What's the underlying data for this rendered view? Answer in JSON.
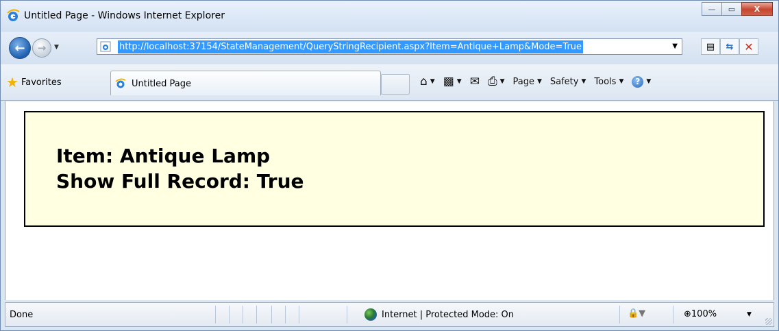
{
  "window": {
    "title": "Untitled Page - Windows Internet Explorer",
    "controls": {
      "minimize": "—",
      "maximize": "▭",
      "close": "X"
    }
  },
  "address_bar": {
    "url": "http://localhost:37154/StateManagement/QueryStringRecipient.aspx?Item=Antique+Lamp&Mode=True",
    "back_icon": "back-arrow-icon",
    "forward_icon": "forward-arrow-icon"
  },
  "favorites": {
    "label": "Favorites"
  },
  "tab": {
    "label": "Untitled Page"
  },
  "command_bar": {
    "page": "Page",
    "safety": "Safety",
    "tools": "Tools"
  },
  "content": {
    "item_line": "Item: Antique Lamp",
    "record_line": "Show Full Record: True",
    "panel_background": "#ffffe1"
  },
  "status_bar": {
    "status": "Done",
    "zone": "Internet | Protected Mode: On",
    "zoom": "100%"
  }
}
